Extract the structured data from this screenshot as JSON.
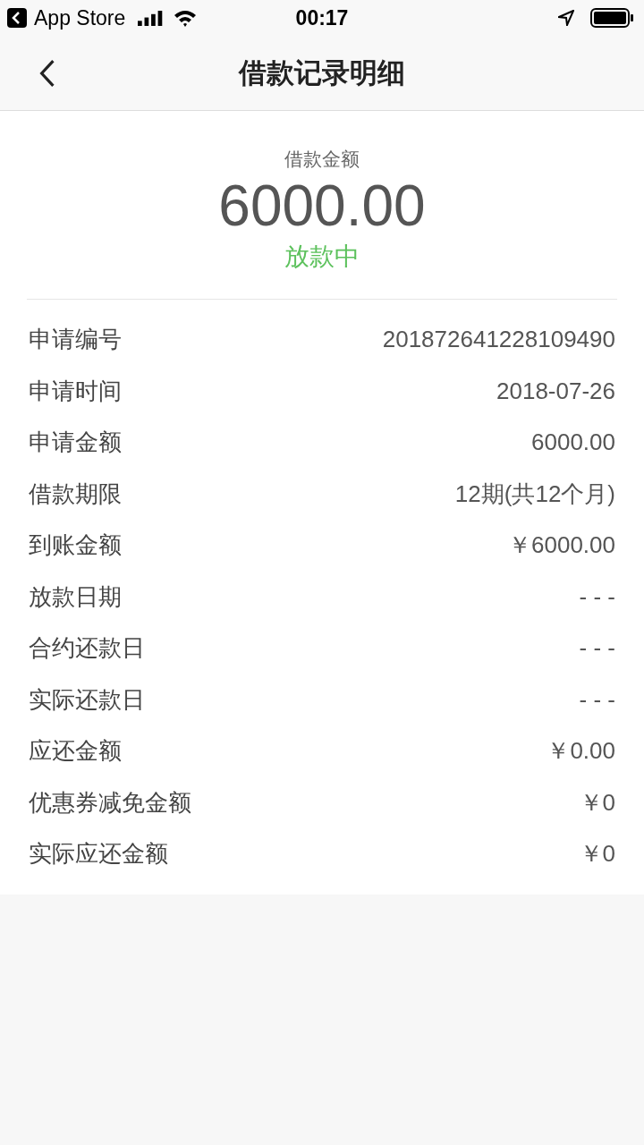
{
  "status_bar": {
    "back_app": "App Store",
    "time": "00:17"
  },
  "nav": {
    "title": "借款记录明细"
  },
  "summary": {
    "label": "借款金额",
    "amount": "6000.00",
    "status": "放款中"
  },
  "details": [
    {
      "label": "申请编号",
      "value": "201872641228109490"
    },
    {
      "label": "申请时间",
      "value": "2018-07-26"
    },
    {
      "label": "申请金额",
      "value": "6000.00"
    },
    {
      "label": "借款期限",
      "value": "12期(共12个月)"
    },
    {
      "label": "到账金额",
      "value": "￥6000.00"
    },
    {
      "label": "放款日期",
      "value": "- - -"
    },
    {
      "label": "合约还款日",
      "value": "- - -"
    },
    {
      "label": "实际还款日",
      "value": "- - -"
    },
    {
      "label": "应还金额",
      "value": "￥0.00"
    },
    {
      "label": "优惠券减免金额",
      "value": "￥0"
    },
    {
      "label": "实际应还金额",
      "value": "￥0"
    }
  ]
}
